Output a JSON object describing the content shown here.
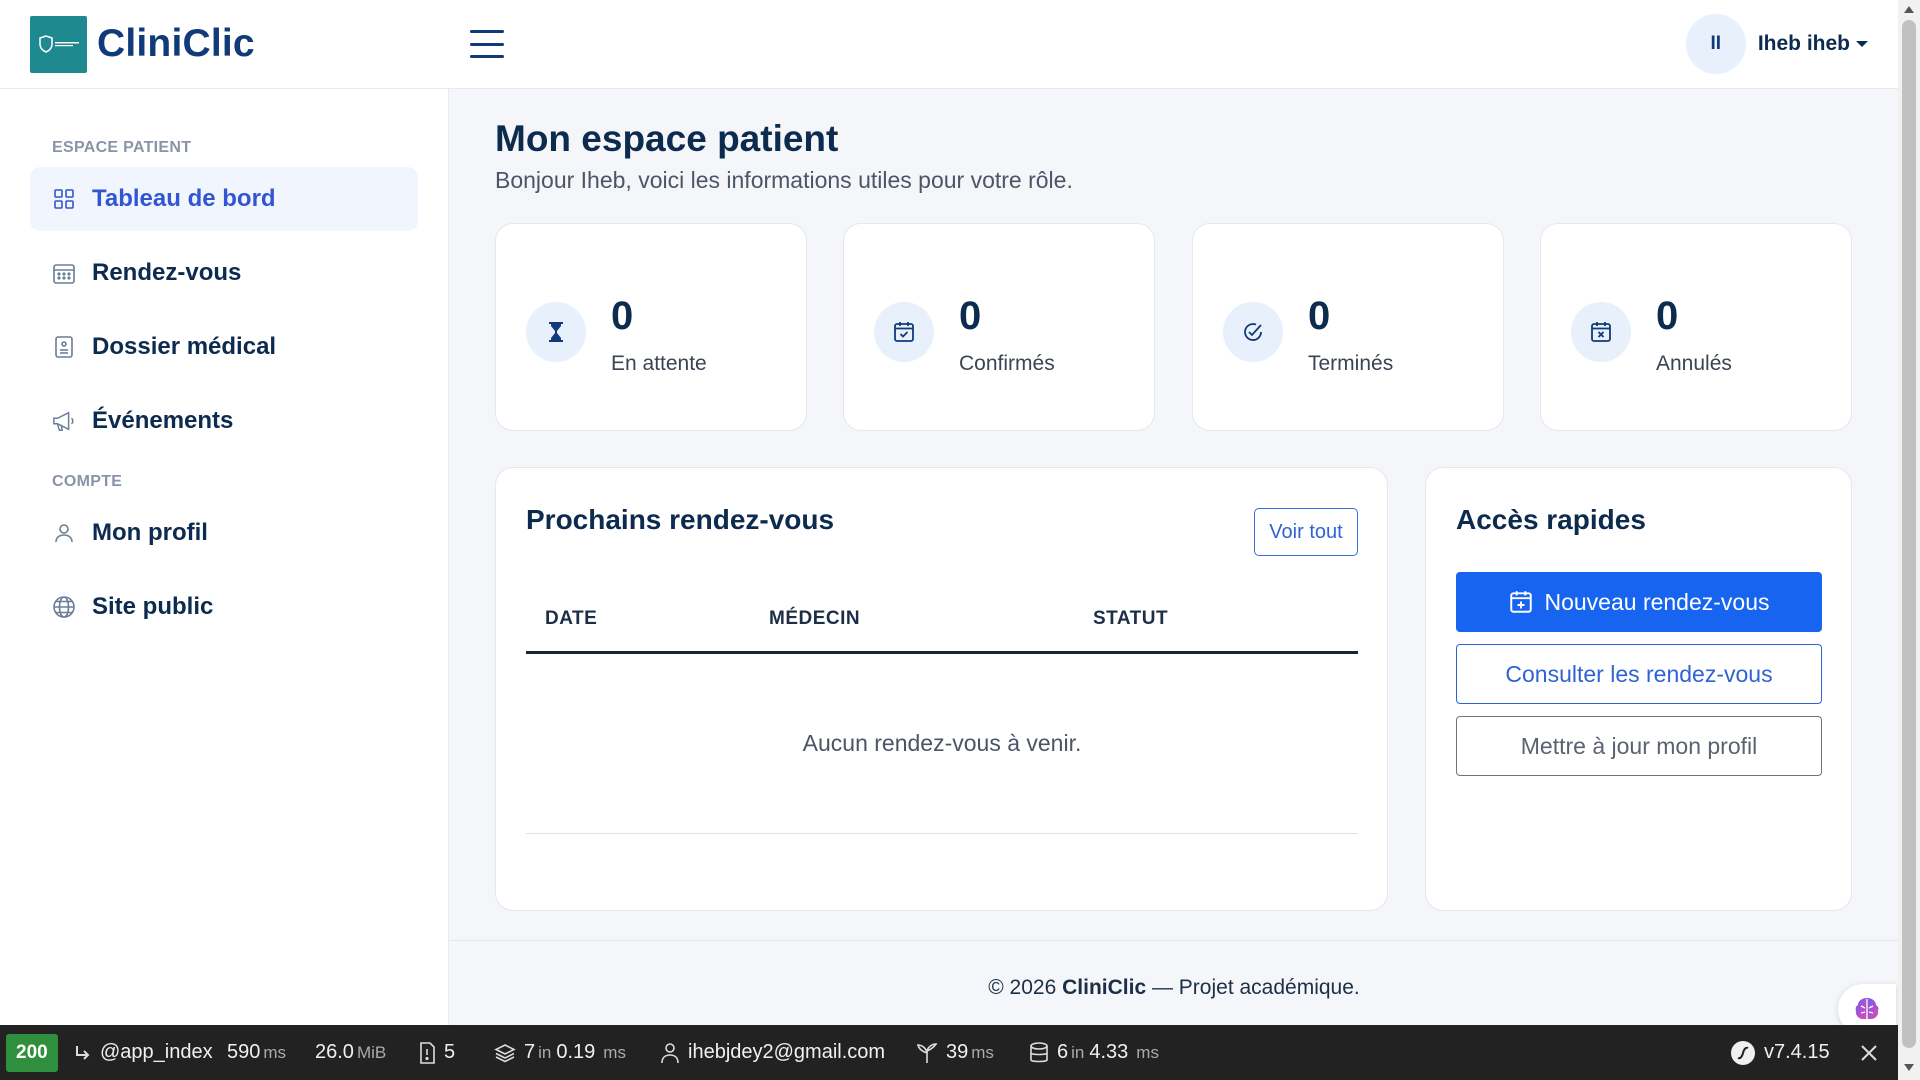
{
  "header": {
    "brand": "CliniClic",
    "logo_text": "CLINICLIC",
    "user_initials": "II",
    "user_name": "Iheb iheb"
  },
  "sidebar": {
    "section_patient": "ESPACE PATIENT",
    "section_account": "COMPTE",
    "items": [
      {
        "label": "Tableau de bord",
        "icon": "grid-icon",
        "active": true
      },
      {
        "label": "Rendez-vous",
        "icon": "calendar-icon"
      },
      {
        "label": "Dossier médical",
        "icon": "document-icon"
      },
      {
        "label": "Événements",
        "icon": "megaphone-icon"
      },
      {
        "label": "Mon profil",
        "icon": "user-icon"
      },
      {
        "label": "Site public",
        "icon": "globe-icon"
      }
    ]
  },
  "main": {
    "title": "Mon espace patient",
    "subtitle": "Bonjour Iheb, voici les informations utiles pour votre rôle.",
    "stats": [
      {
        "value": "0",
        "label": "En attente",
        "icon": "hourglass-icon"
      },
      {
        "value": "0",
        "label": "Confirmés",
        "icon": "calendar-check-icon"
      },
      {
        "value": "0",
        "label": "Terminés",
        "icon": "check-circle-icon"
      },
      {
        "value": "0",
        "label": "Annulés",
        "icon": "calendar-x-icon"
      }
    ],
    "appointments": {
      "title": "Prochains rendez-vous",
      "see_all": "Voir tout",
      "columns": [
        "DATE",
        "MÉDECIN",
        "STATUT"
      ],
      "empty": "Aucun rendez-vous à venir."
    },
    "quick_access": {
      "title": "Accès rapides",
      "new_appointment": "Nouveau rendez-vous",
      "view_appointments": "Consulter les rendez-vous",
      "update_profile": "Mettre à jour mon profil"
    }
  },
  "footer": {
    "prefix": "© 2026 ",
    "brand": "CliniClic",
    "suffix": " — Projet académique."
  },
  "debug_toolbar": {
    "status": "200",
    "route": "@app_index",
    "time_value": "590",
    "time_unit": "ms",
    "memory_value": "26.0",
    "memory_unit": "MiB",
    "logs": "5",
    "cache_value": "7",
    "cache_in": "in",
    "cache_time": "0.19",
    "cache_unit": "ms",
    "user": "ihebjdey2@gmail.com",
    "twig_value": "39",
    "twig_unit": "ms",
    "db_value": "6",
    "db_in": "in",
    "db_time": "4.33",
    "db_unit": "ms",
    "version": "v7.4.15"
  },
  "colors": {
    "primary": "#1764f0",
    "navy": "#113a78",
    "teal_logo": "#1e8a8f",
    "status_ok": "#2f8f3d"
  }
}
